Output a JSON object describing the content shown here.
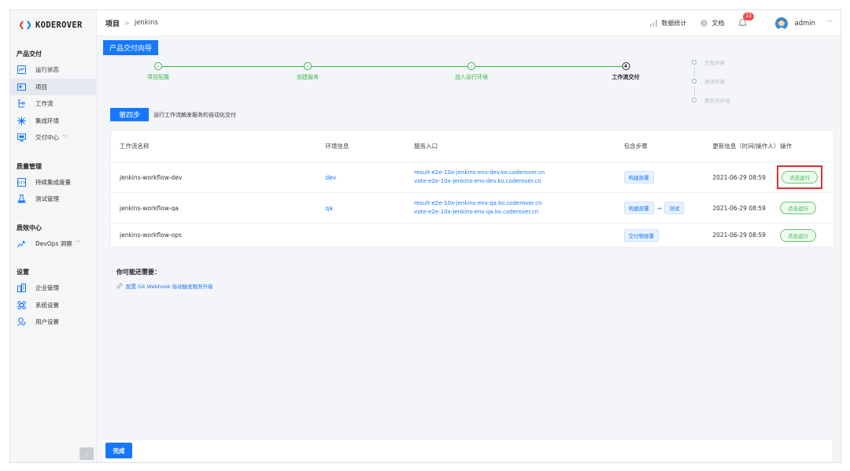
{
  "app": {
    "logo_text": "KODEROVER"
  },
  "sidebar": {
    "groups": [
      {
        "title": "产品交付",
        "items": [
          {
            "label": "运行状态",
            "icon": "dashboard-icon"
          },
          {
            "label": "项目",
            "icon": "project-icon",
            "active": true
          },
          {
            "label": "工作流",
            "icon": "workflow-icon"
          },
          {
            "label": "集成环境",
            "icon": "environment-icon"
          },
          {
            "label": "交付中心",
            "icon": "delivery-icon",
            "caret": "﹀"
          }
        ]
      },
      {
        "title": "质量管理",
        "items": [
          {
            "label": "持续集成度量",
            "icon": "ci-metrics-icon"
          },
          {
            "label": "测试管理",
            "icon": "test-icon"
          }
        ]
      },
      {
        "title": "质效中心",
        "items": [
          {
            "label": "DevOps 洞察",
            "icon": "insight-icon",
            "caret": "﹀"
          }
        ]
      },
      {
        "title": "设置",
        "items": [
          {
            "label": "企业管理",
            "icon": "enterprise-icon"
          },
          {
            "label": "系统设置",
            "icon": "system-settings-icon"
          },
          {
            "label": "用户设置",
            "icon": "user-settings-icon"
          }
        ]
      }
    ],
    "collapse_label": "‹"
  },
  "breadcrumb": {
    "root": "项目",
    "separator": ">",
    "leaf": "jenkins"
  },
  "topbar": {
    "stats_label": "数据统计",
    "docs_label": "文档",
    "notification_count": "13",
    "username": "admin"
  },
  "guide": {
    "title": "产品交付向导"
  },
  "steps": [
    {
      "label": "项目配置",
      "mark": "✓",
      "state": "done"
    },
    {
      "label": "创建服务",
      "mark": "✓",
      "state": "done"
    },
    {
      "label": "加入运行环境",
      "mark": "✓",
      "state": "done"
    },
    {
      "label": "工作流交付",
      "mark": "4",
      "state": "current"
    }
  ],
  "environments": [
    "开发环境",
    "测试环境",
    "预发布环境"
  ],
  "step4": {
    "tag": "第四步",
    "description": "运行工作流触发服务的自动化交付"
  },
  "table": {
    "headers": {
      "name": "工作流名称",
      "env": "环境信息",
      "entry": "服务入口",
      "steps": "包含步骤",
      "updated": "更新信息（时间/操作人）",
      "action": "操作"
    },
    "rows": [
      {
        "name": "jenkins-workflow-dev",
        "env": "dev",
        "entries": [
          "result-e2e-10x-jenkins-env-dev.ko.coderover.cn",
          "vote-e2e-10x-jenkins-env-dev.ko.coderover.cn"
        ],
        "steps": [
          "构建部署"
        ],
        "updated": "2021-06-29 08:59",
        "action": "点击运行",
        "highlight": true
      },
      {
        "name": "jenkins-workflow-qa",
        "env": "qa",
        "entries": [
          "result-e2e-10x-jenkins-env-qa.ko.coderover.cn",
          "vote-e2e-10x-jenkins-env-qa.ko.coderover.cn"
        ],
        "steps": [
          "构建部署",
          "测试"
        ],
        "updated": "2021-06-29 08:59",
        "action": "点击运行",
        "highlight": false
      },
      {
        "name": "jenkins-workflow-ops",
        "env": "",
        "entries": [],
        "steps": [
          "交付物部署"
        ],
        "updated": "2021-06-29 08:59",
        "action": "点击运行",
        "highlight": false
      }
    ]
  },
  "hint": {
    "title": "你可能还需要：",
    "link": "配置 Git Webhook 自动触发服务升级"
  },
  "footer": {
    "done_label": "完成"
  },
  "colors": {
    "primary": "#1677ff",
    "success": "#35b34a",
    "highlight": "#d9332b",
    "badge": "#f04b4b"
  }
}
